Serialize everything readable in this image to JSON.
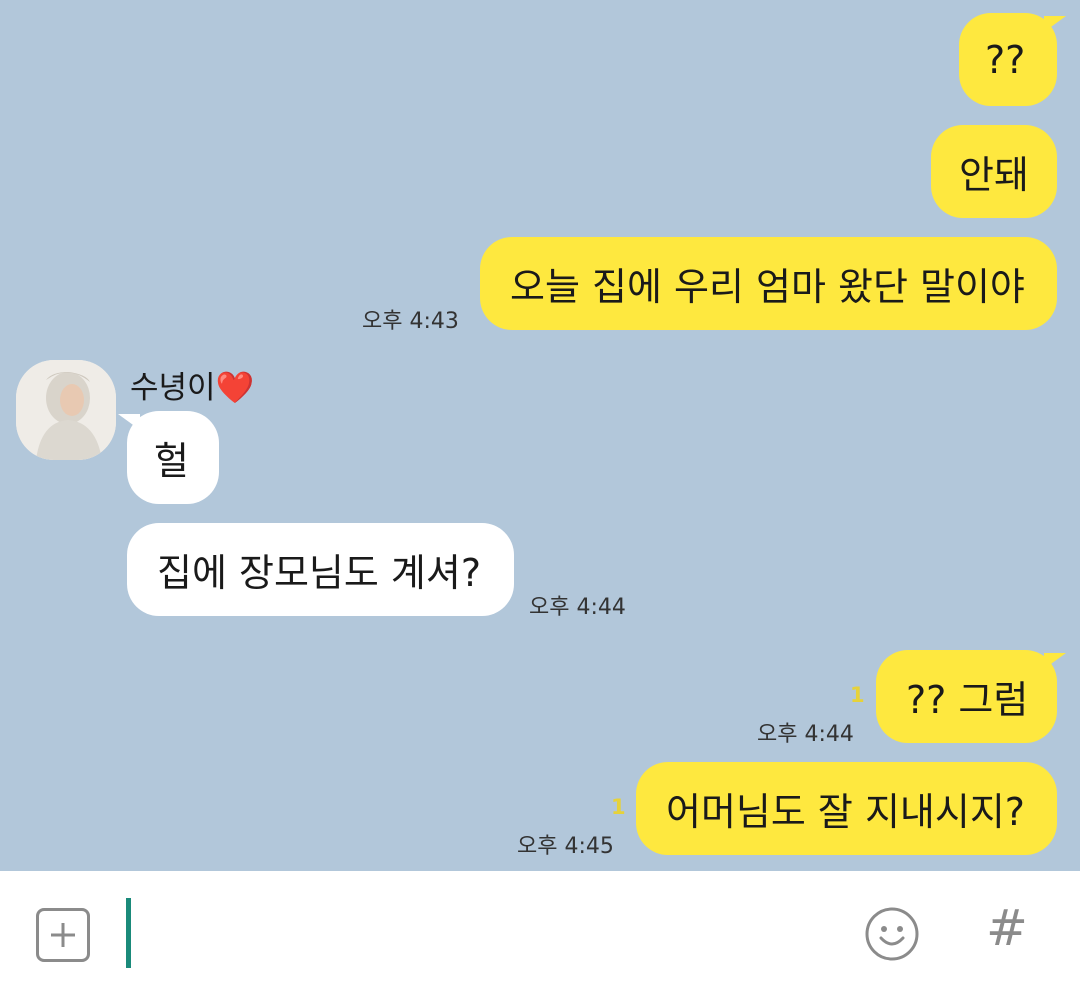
{
  "messages": {
    "m1": {
      "text": "??"
    },
    "m2": {
      "text": "안돼"
    },
    "m3": {
      "text": "오늘 집에 우리 엄마 왔단 말이야",
      "time": "오후 4:43"
    },
    "sender_name": "수녕이",
    "sender_heart": "❤️",
    "m4": {
      "text": "헐"
    },
    "m5": {
      "text": "집에 장모님도 계셔?",
      "time": "오후 4:44"
    },
    "m6": {
      "text": "?? 그럼",
      "time": "오후 4:44",
      "unread": "1"
    },
    "m7": {
      "text": "어머님도 잘 지내시지?",
      "time": "오후 4:45",
      "unread": "1"
    }
  },
  "input": {
    "plus_icon": "plus-icon",
    "emoji_icon": "emoji-icon",
    "hash_label": "#"
  },
  "colors": {
    "background": "#b2c7da",
    "my_bubble": "#fee83f",
    "their_bubble": "#ffffff",
    "caret": "#1a8a7a"
  }
}
